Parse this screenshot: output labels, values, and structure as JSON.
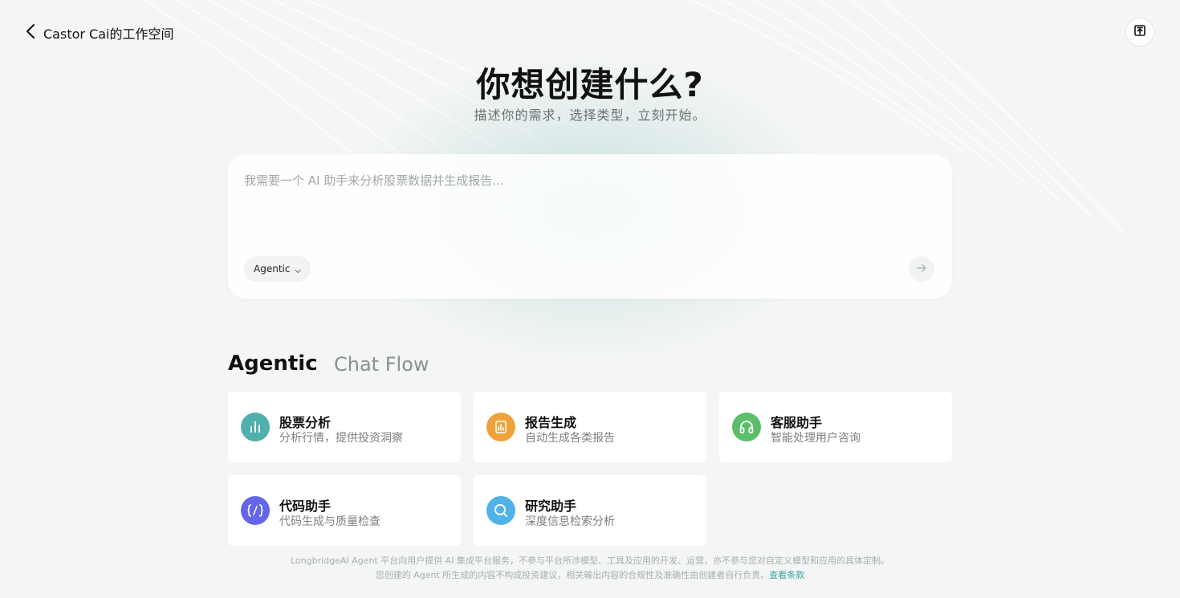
{
  "header": {
    "back_label": "Castor Cai的工作空间"
  },
  "hero": {
    "title": "你想创建什么?",
    "subtitle": "描述你的需求，选择类型，立刻开始。"
  },
  "prompt": {
    "placeholder": "我需要一个 AI 助手来分析股票数据并生成报告...",
    "value": "",
    "mode_label": "Agentic"
  },
  "tabs": [
    {
      "label": "Agentic",
      "active": true
    },
    {
      "label": "Chat Flow",
      "active": false
    }
  ],
  "templates": [
    {
      "title": "股票分析",
      "desc": "分析行情，提供投资洞察",
      "icon": "bar-chart-icon",
      "color": "#4fb0ad"
    },
    {
      "title": "报告生成",
      "desc": "自动生成各类报告",
      "icon": "report-icon",
      "color": "#f0a23a"
    },
    {
      "title": "客服助手",
      "desc": "智能处理用户咨询",
      "icon": "headset-icon",
      "color": "#5cbd6a"
    },
    {
      "title": "代码助手",
      "desc": "代码生成与质量检查",
      "icon": "code-icon",
      "color": "#6366e8"
    },
    {
      "title": "研究助手",
      "desc": "深度信息检索分析",
      "icon": "search-icon",
      "color": "#4fb2e8"
    }
  ],
  "footer": {
    "line1": "LongbridgeAI Agent 平台向用户提供 AI 集成平台服务，不参与平台所涉模型、工具及应用的开发、运营，亦不参与您对自定义模型和应用的具体定制。",
    "line2": "您创建的 Agent 所生成的内容不构成投资建议，相关输出内容的合规性及准确性由创建者自行负责。",
    "terms_link": "查看条款"
  }
}
